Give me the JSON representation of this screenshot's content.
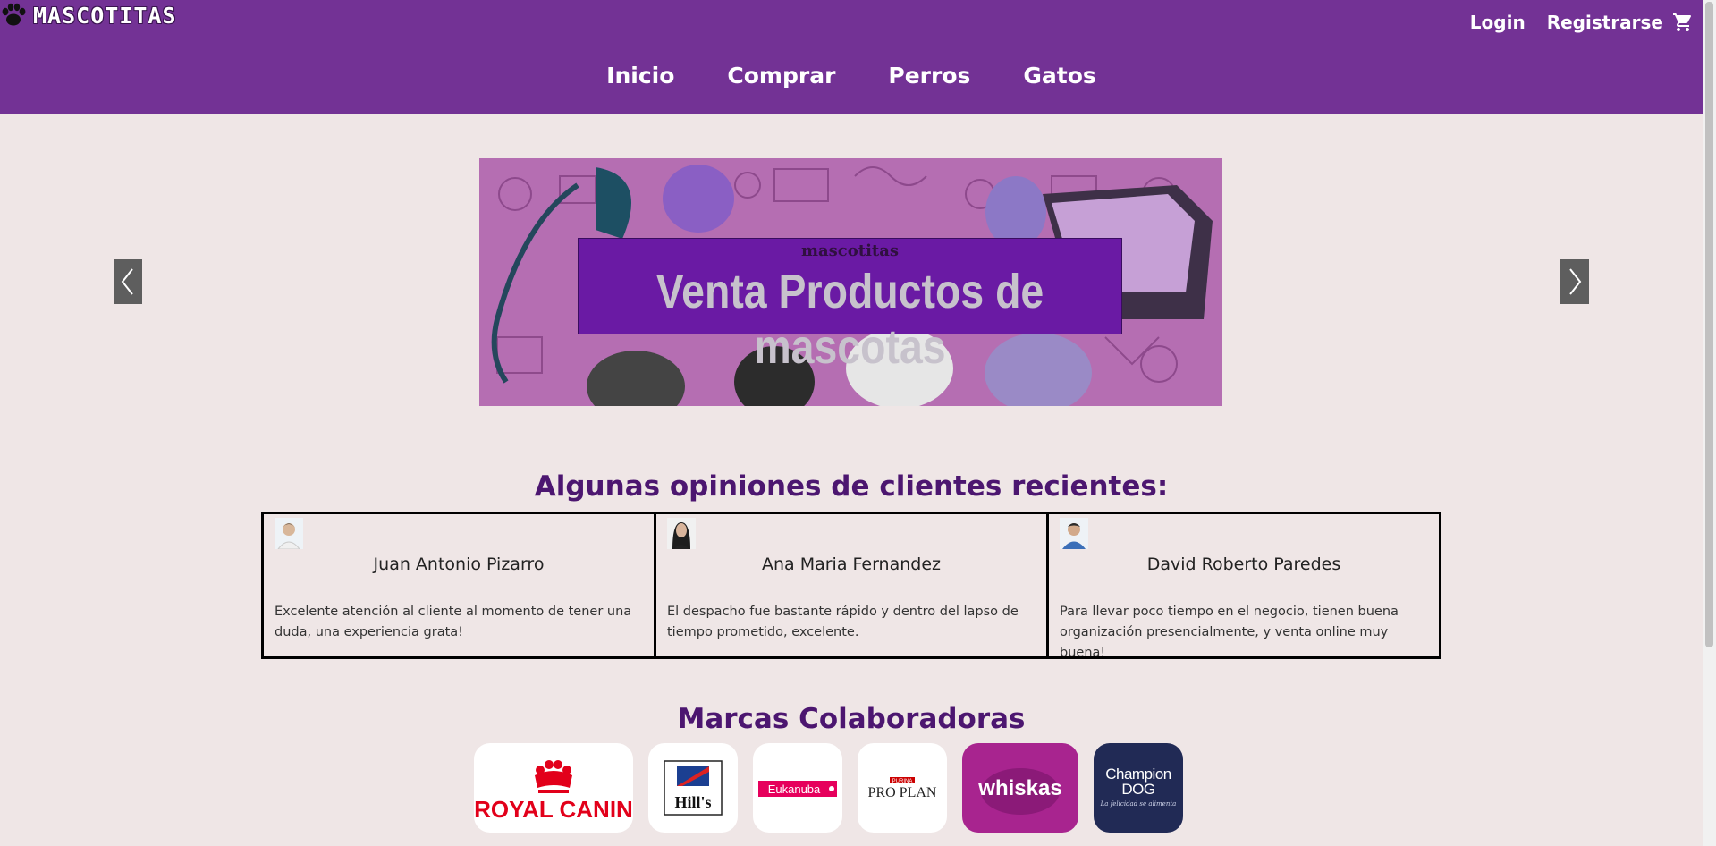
{
  "header": {
    "logo_text": "MASCOTITAS",
    "login_label": "Login",
    "register_label": "Registrarse",
    "nav": [
      "Inicio",
      "Comprar",
      "Perros",
      "Gatos"
    ]
  },
  "banner": {
    "brand": "mascotitas",
    "title": "Venta Productos de mascotas"
  },
  "reviews_section": {
    "title": "Algunas opiniones de clientes recientes:",
    "items": [
      {
        "name": "Juan Antonio Pizarro",
        "text": "Excelente atención al cliente al momento de tener una duda, una experiencia grata!"
      },
      {
        "name": "Ana Maria Fernandez",
        "text": "El despacho fue bastante rápido y dentro del lapso de tiempo prometido, excelente."
      },
      {
        "name": "David Roberto Paredes",
        "text": "Para llevar poco tiempo en el negocio, tienen buena organización presencialmente, y venta online muy buena!"
      }
    ]
  },
  "brands_section": {
    "title": "Marcas Colaboradoras",
    "logos": [
      {
        "name": "ROYAL CANIN"
      },
      {
        "name": "Hill's"
      },
      {
        "name": "Eukanuba"
      },
      {
        "name": "PURINA",
        "sub": "PRO PLAN"
      },
      {
        "name": "whiskas"
      },
      {
        "name": "Champion DOG",
        "tagline": "La felicidad se alimenta"
      }
    ]
  },
  "colors": {
    "header_bg": "#733295",
    "page_bg": "#efe6e6",
    "title_color": "#4c1670"
  }
}
